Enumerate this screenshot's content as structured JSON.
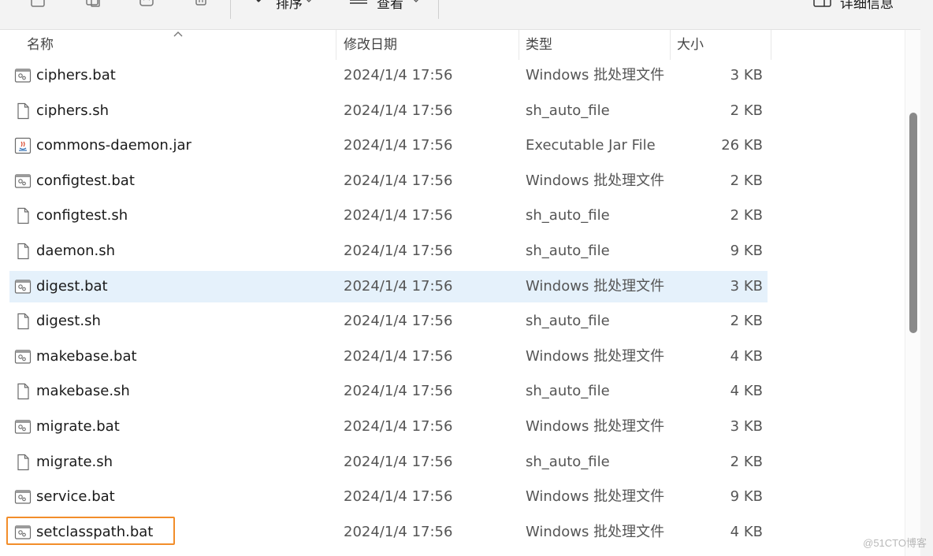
{
  "toolbar": {
    "sort_label": "排序",
    "view_label": "查看",
    "more_label": "···",
    "details_label": "详细信息"
  },
  "columns": {
    "name": "名称",
    "date": "修改日期",
    "type": "类型",
    "size": "大小"
  },
  "files": [
    {
      "name": "ciphers.bat",
      "date": "2024/1/4 17:56",
      "type": "Windows 批处理文件",
      "size": "3 KB",
      "icon": "batch-file-icon"
    },
    {
      "name": "ciphers.sh",
      "date": "2024/1/4 17:56",
      "type": "sh_auto_file",
      "size": "2 KB",
      "icon": "generic-file-icon"
    },
    {
      "name": "commons-daemon.jar",
      "date": "2024/1/4 17:56",
      "type": "Executable Jar File",
      "size": "26 KB",
      "icon": "java-jar-icon"
    },
    {
      "name": "configtest.bat",
      "date": "2024/1/4 17:56",
      "type": "Windows 批处理文件",
      "size": "2 KB",
      "icon": "batch-file-icon"
    },
    {
      "name": "configtest.sh",
      "date": "2024/1/4 17:56",
      "type": "sh_auto_file",
      "size": "2 KB",
      "icon": "generic-file-icon"
    },
    {
      "name": "daemon.sh",
      "date": "2024/1/4 17:56",
      "type": "sh_auto_file",
      "size": "9 KB",
      "icon": "generic-file-icon"
    },
    {
      "name": "digest.bat",
      "date": "2024/1/4 17:56",
      "type": "Windows 批处理文件",
      "size": "3 KB",
      "icon": "batch-file-icon"
    },
    {
      "name": "digest.sh",
      "date": "2024/1/4 17:56",
      "type": "sh_auto_file",
      "size": "2 KB",
      "icon": "generic-file-icon"
    },
    {
      "name": "makebase.bat",
      "date": "2024/1/4 17:56",
      "type": "Windows 批处理文件",
      "size": "4 KB",
      "icon": "batch-file-icon"
    },
    {
      "name": "makebase.sh",
      "date": "2024/1/4 17:56",
      "type": "sh_auto_file",
      "size": "4 KB",
      "icon": "generic-file-icon"
    },
    {
      "name": "migrate.bat",
      "date": "2024/1/4 17:56",
      "type": "Windows 批处理文件",
      "size": "3 KB",
      "icon": "batch-file-icon"
    },
    {
      "name": "migrate.sh",
      "date": "2024/1/4 17:56",
      "type": "sh_auto_file",
      "size": "2 KB",
      "icon": "generic-file-icon"
    },
    {
      "name": "service.bat",
      "date": "2024/1/4 17:56",
      "type": "Windows 批处理文件",
      "size": "9 KB",
      "icon": "batch-file-icon"
    },
    {
      "name": "setclasspath.bat",
      "date": "2024/1/4 17:56",
      "type": "Windows 批处理文件",
      "size": "4 KB",
      "icon": "batch-file-icon"
    }
  ],
  "state": {
    "hovered_index": 6,
    "highlighted_index": 13
  },
  "colors": {
    "hover": "#e5f1fb",
    "highlight_box": "#f28d2a"
  },
  "watermark": "@51CTO博客"
}
